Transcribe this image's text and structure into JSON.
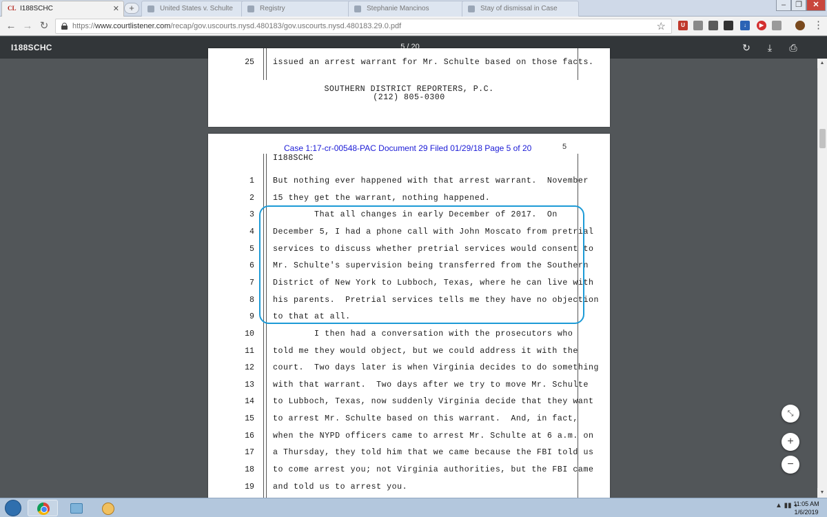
{
  "browser": {
    "active_tab_title": "I188SCHC",
    "background_tabs": [
      "United States v. Schulte",
      "Registry",
      "Stephanie Mancinos",
      "Stay of dismissal in Case"
    ],
    "url_scheme": "https://",
    "url_host": "www.courtlistener.com",
    "url_path": "/recap/gov.uscourts.nysd.480183/gov.uscourts.nysd.480183.29.0.pdf"
  },
  "pdf_toolbar": {
    "title": "I188SCHC",
    "page_indicator": "5 / 20"
  },
  "prev_page": {
    "line_number": "25",
    "line_text": "issued an arrest warrant for Mr. Schulte based on those facts.",
    "reporter_name": "SOUTHERN DISTRICT REPORTERS, P.C.",
    "reporter_phone": "(212) 805-0300"
  },
  "current_page": {
    "case_stamp": "Case 1:17-cr-00548-PAC   Document 29   Filed 01/29/18   Page 5 of 20",
    "page_number": "5",
    "header_code": "I188SCHC",
    "lines": [
      {
        "n": "1",
        "text": "But nothing ever happened with that arrest warrant.  November"
      },
      {
        "n": "2",
        "text": "15 they get the warrant, nothing happened."
      },
      {
        "n": "3",
        "text": "        That all changes in early December of 2017.  On"
      },
      {
        "n": "4",
        "text": "December 5, I had a phone call with John Moscato from pretrial"
      },
      {
        "n": "5",
        "text": "services to discuss whether pretrial services would consent to"
      },
      {
        "n": "6",
        "text": "Mr. Schulte's supervision being transferred from the Southern"
      },
      {
        "n": "7",
        "text": "District of New York to Lubboch, Texas, where he can live with"
      },
      {
        "n": "8",
        "text": "his parents.  Pretrial services tells me they have no objection"
      },
      {
        "n": "9",
        "text": "to that at all."
      },
      {
        "n": "10",
        "text": "        I then had a conversation with the prosecutors who"
      },
      {
        "n": "11",
        "text": "told me they would object, but we could address it with the"
      },
      {
        "n": "12",
        "text": "court.  Two days later is when Virginia decides to do something"
      },
      {
        "n": "13",
        "text": "with that warrant.  Two days after we try to move Mr. Schulte"
      },
      {
        "n": "14",
        "text": "to Lubboch, Texas, now suddenly Virginia decide that they want"
      },
      {
        "n": "15",
        "text": "to arrest Mr. Schulte based on this warrant.  And, in fact,"
      },
      {
        "n": "16",
        "text": "when the NYPD officers came to arrest Mr. Schulte at 6 a.m. on"
      },
      {
        "n": "17",
        "text": "a Thursday, they told him that we came because the FBI told us"
      },
      {
        "n": "18",
        "text": "to come arrest you; not Virginia authorities, but the FBI came"
      },
      {
        "n": "19",
        "text": "and told us to arrest you."
      }
    ]
  },
  "colors": {
    "highlight": "#1c9ad6",
    "case_stamp": "#1a1ad6",
    "pdf_toolbar": "#323639",
    "viewer_bg": "#525659"
  },
  "icons": {
    "rotate": "rotate-icon",
    "download": "download-icon",
    "print": "print-icon",
    "fit_page": "fit-page-icon",
    "zoom_in": "zoom-in-icon",
    "zoom_out": "zoom-out-icon"
  },
  "zoom": {
    "zoom_in_label": "+",
    "zoom_out_label": "−"
  },
  "taskbar": {
    "time": "11:05 AM",
    "date": "1/6/2019"
  }
}
